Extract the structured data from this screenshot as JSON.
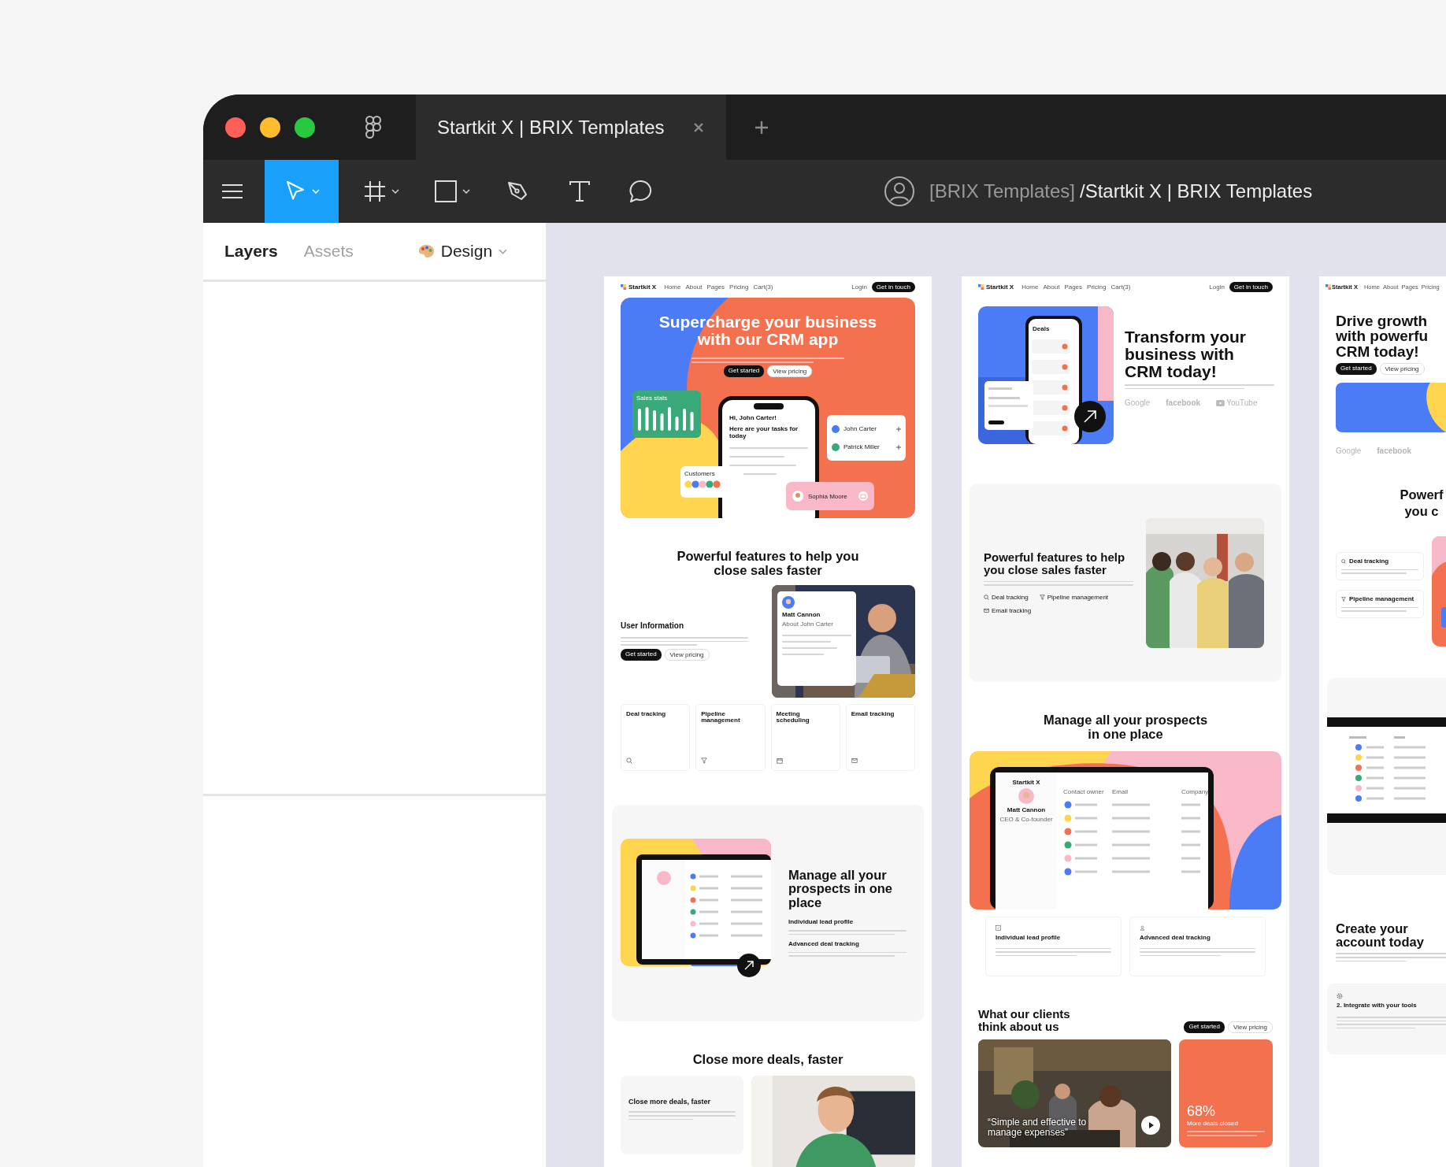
{
  "window": {
    "tab_title": "Startkit X | BRIX Templates",
    "breadcrumb_team": "[BRIX Templates]",
    "breadcrumb_file": "/Startkit X | BRIX Templates"
  },
  "tools": [
    {
      "kind": "move",
      "selected": true,
      "dropdown": true
    },
    {
      "kind": "frame",
      "selected": false,
      "dropdown": true
    },
    {
      "kind": "rectangle",
      "selected": false,
      "dropdown": true
    },
    {
      "kind": "pen",
      "selected": false,
      "dropdown": false
    },
    {
      "kind": "text",
      "selected": false,
      "dropdown": false
    },
    {
      "kind": "comment",
      "selected": false,
      "dropdown": false
    }
  ],
  "panel": {
    "tabs": [
      {
        "label": "Layers",
        "selected": true
      },
      {
        "label": "Assets",
        "selected": false
      }
    ],
    "design": "Design"
  },
  "frame_1": {
    "nav": {
      "brand": "Startkit X",
      "links": [
        "Home",
        "About",
        "Pages",
        "Pricing",
        "Cart(3)"
      ],
      "login": "Login",
      "cta": "Get in touch"
    },
    "hero": {
      "title": "Supercharge your business with our CRM app",
      "buttons": [
        "Get started",
        "View pricing"
      ],
      "stats_card": "Sales stats",
      "greeting": "Hi, John Carter!",
      "tasks_title": "Here are your tasks for today",
      "contacts": [
        "John Carter",
        "Patrick Miller"
      ],
      "customers": "Customers",
      "toast_name": "Sophia Moore"
    },
    "features": {
      "title": "Powerful features to help you close sales faster",
      "info_title": "User Information",
      "buttons": [
        "Get started",
        "View pricing"
      ],
      "profile_name": "Matt Cannon",
      "profile_about": "About John Carter",
      "cards": [
        {
          "title": "Deal tracking",
          "kind": "search"
        },
        {
          "title": "Pipeline management",
          "kind": "filter"
        },
        {
          "title": "Meeting scheduling",
          "kind": "calendar"
        },
        {
          "title": "Email tracking",
          "kind": "mail"
        }
      ]
    },
    "prospects": {
      "title": "Manage all your prospects in one place",
      "items": [
        "Individual lead profile",
        "Advanced deal tracking"
      ]
    },
    "deals": {
      "title": "Close more deals, faster",
      "card_title": "Close more deals, faster"
    }
  },
  "frame_2": {
    "nav": {
      "brand": "Startkit X",
      "links": [
        "Home",
        "About",
        "Pages",
        "Pricing",
        "Cart(3)"
      ],
      "login": "Login",
      "cta": "Get in touch"
    },
    "hero": {
      "title": "Transform your business with CRM today!",
      "phone_title": "Deals",
      "logos": [
        "Google",
        "facebook",
        "YouTube"
      ]
    },
    "features": {
      "title": "Powerful features to help you close sales faster",
      "items": [
        {
          "label": "Deal tracking",
          "kind": "search"
        },
        {
          "label": "Pipeline management",
          "kind": "filter"
        },
        {
          "label": "Email tracking",
          "kind": "mail"
        }
      ]
    },
    "prospects": {
      "title": "Manage all your prospects in one place",
      "brand": "Startkit X",
      "profile_name": "Matt Cannon",
      "profile_role": "CEO & Co-founder",
      "columns": [
        "Contact owner",
        "Email",
        "Company"
      ],
      "cards": [
        {
          "title": "Individual lead profile",
          "kind": "checklist"
        },
        {
          "title": "Advanced deal tracking",
          "kind": "user"
        }
      ]
    },
    "testimonials": {
      "title": "What our clients think about us",
      "buttons": [
        "Get started",
        "View pricing"
      ],
      "quote": "“Simple and effective to manage expenses”",
      "stat": "68%",
      "stat_label": "More deals closed"
    }
  },
  "frame_3": {
    "nav": {
      "brand": "Startkit X",
      "links": [
        "Home",
        "About",
        "Pages",
        "Pricing"
      ]
    },
    "hero": {
      "title_lines": [
        "Drive growth",
        "with powerfu",
        "CRM today!"
      ],
      "buttons": [
        "Get started",
        "View pricing"
      ],
      "logos": [
        "Google",
        "facebook"
      ]
    },
    "features": {
      "title_lines": [
        "Powerf",
        "you c"
      ],
      "cards": [
        {
          "title": "Deal tracking",
          "kind": "search"
        },
        {
          "title": "Pipeline management",
          "kind": "filter"
        }
      ]
    },
    "signup": {
      "title": "Create your account today",
      "step": "2. Integrate with your tools"
    }
  }
}
